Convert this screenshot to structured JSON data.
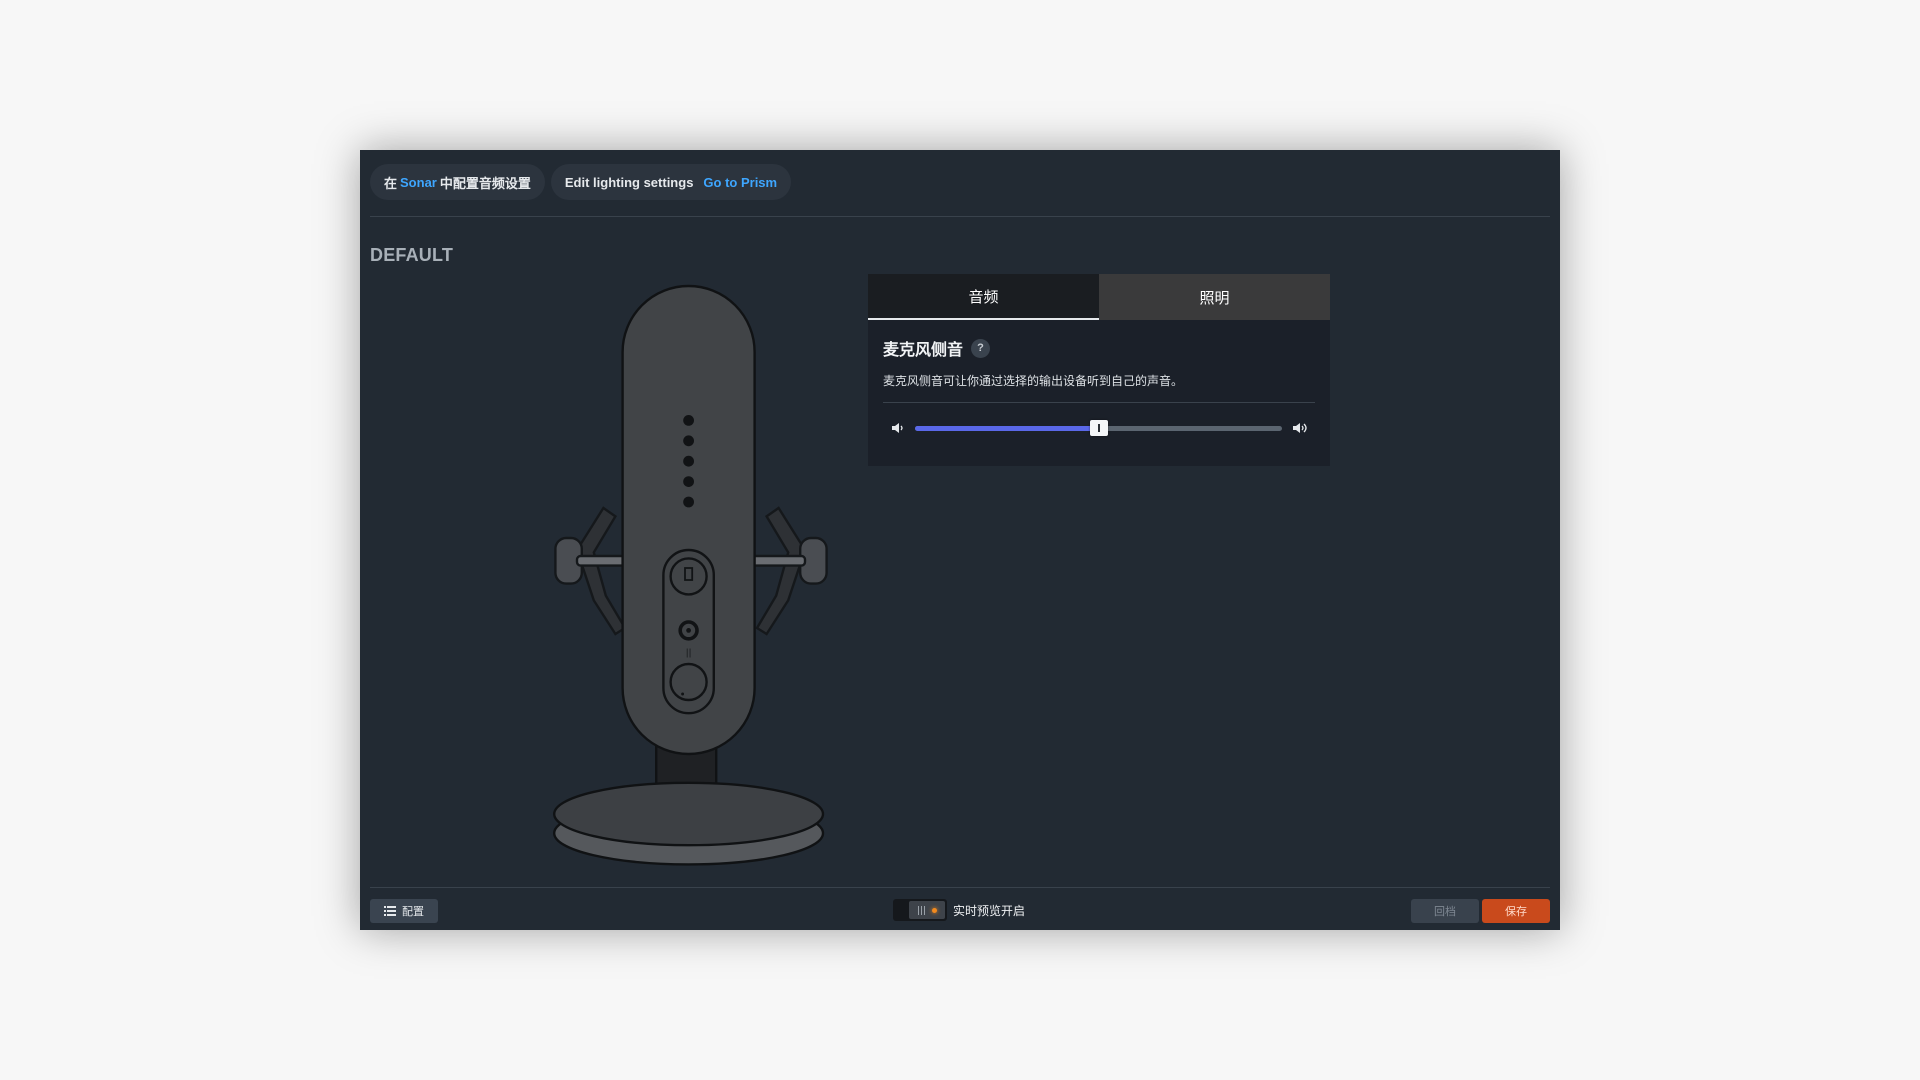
{
  "topbar": {
    "sonar_prefix": "在",
    "sonar_link": "Sonar",
    "sonar_suffix": "中配置音频设置",
    "lighting_label": "Edit lighting settings",
    "prism_link": "Go to Prism"
  },
  "profile": {
    "name": "DEFAULT"
  },
  "device": {
    "icon": "microphone-illustration"
  },
  "tabs": [
    {
      "label": "音频",
      "active": true
    },
    {
      "label": "照明",
      "active": false
    }
  ],
  "sidetone": {
    "title": "麦克风侧音",
    "help_label": "?",
    "description": "麦克风侧音可让你通过选择的输出设备听到自己的声音。",
    "level_fraction": 0.5
  },
  "bottombar": {
    "config_label": "配置",
    "preview_label": "实时预览开启",
    "revert_label": "回档",
    "save_label": "保存"
  },
  "colors": {
    "window_bg": "#222a33",
    "link": "#3ea6ff",
    "slider_fill": "#5a68e8",
    "save_button": "#c94a1c",
    "preview_indicator": "#f28a1e"
  }
}
